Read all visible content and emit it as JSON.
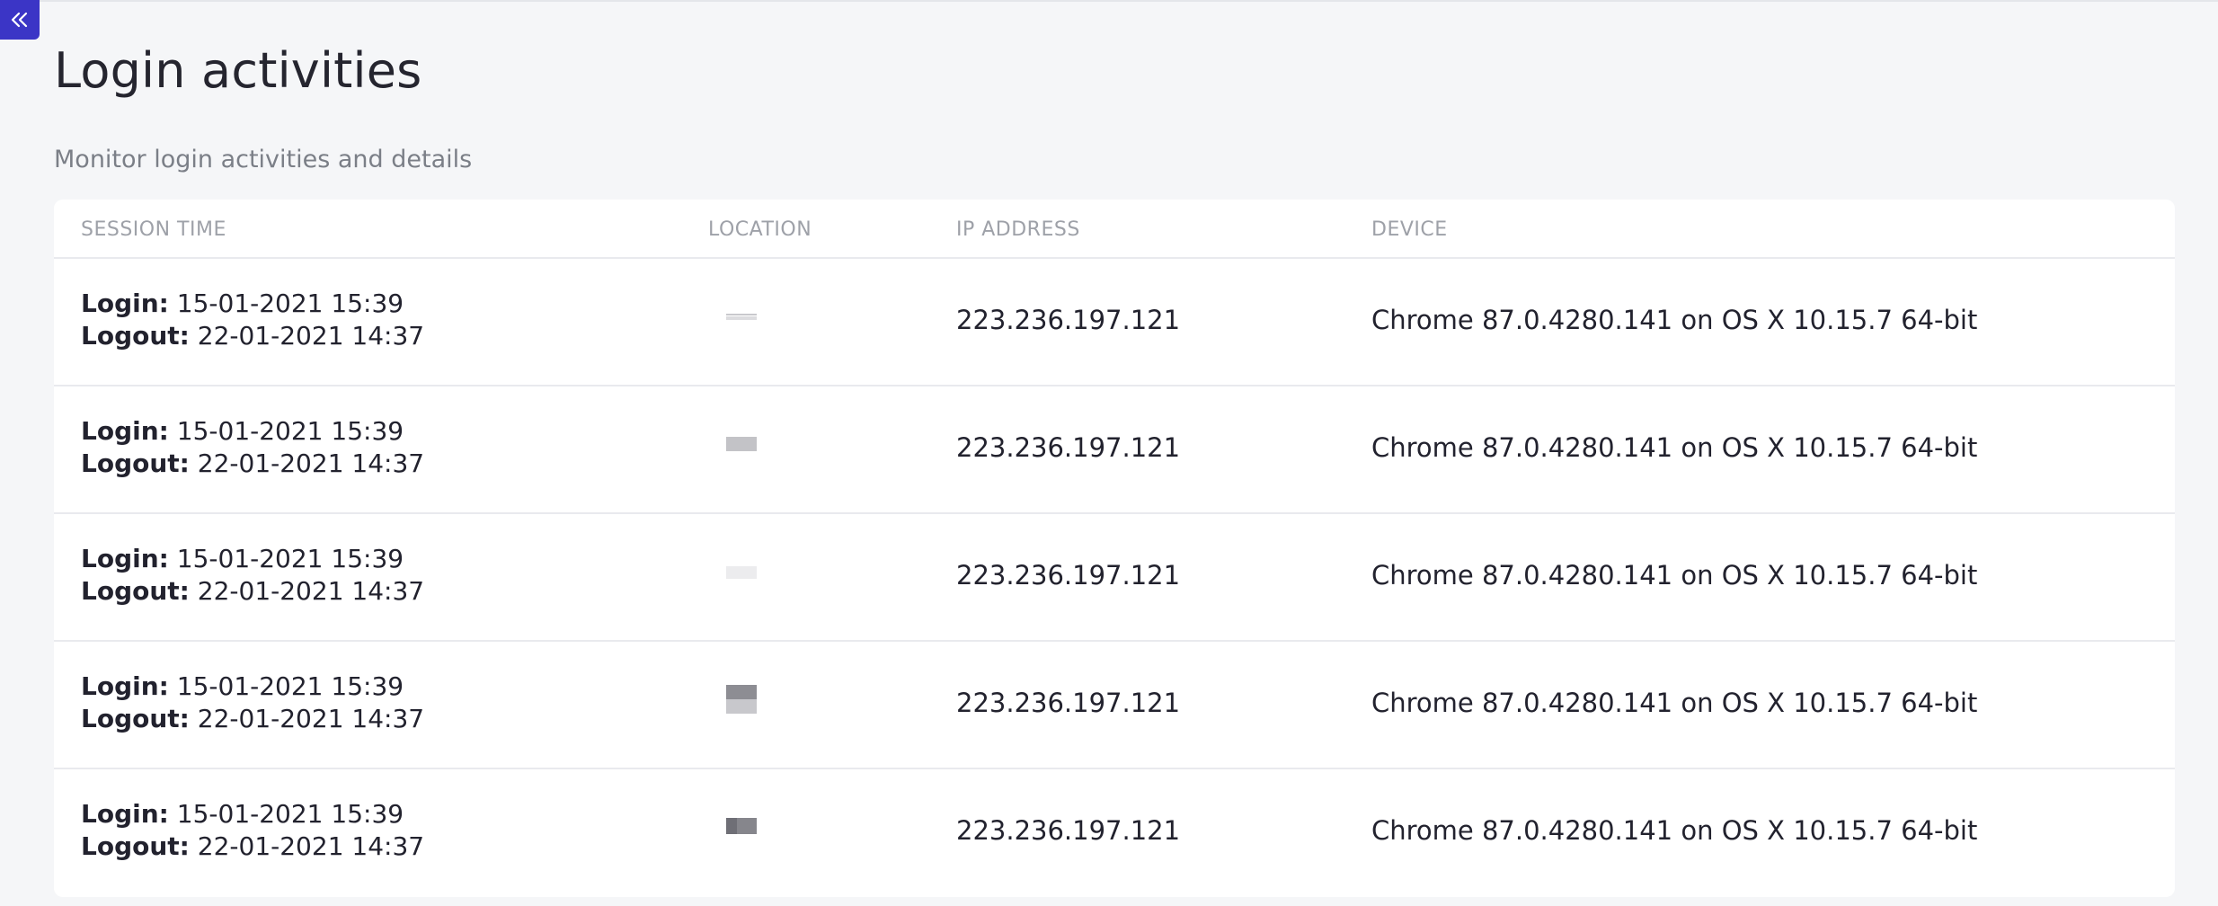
{
  "page": {
    "title": "Login activities",
    "subtitle": "Monitor login activities and details"
  },
  "table": {
    "headers": {
      "session_time": "SESSION TIME",
      "location": "LOCATION",
      "ip_address": "IP ADDRESS",
      "device": "DEVICE"
    },
    "rows": [
      {
        "login_label": "Login:",
        "login": "15-01-2021 15:39",
        "logout_label": "Logout:",
        "logout": "22-01-2021 14:37",
        "ip": "223.236.197.121",
        "device": "Chrome 87.0.4280.141 on OS X 10.15.7 64-bit"
      },
      {
        "login_label": "Login:",
        "login": "15-01-2021 15:39",
        "logout_label": "Logout:",
        "logout": "22-01-2021 14:37",
        "ip": "223.236.197.121",
        "device": "Chrome 87.0.4280.141 on OS X 10.15.7 64-bit"
      },
      {
        "login_label": "Login:",
        "login": "15-01-2021 15:39",
        "logout_label": "Logout:",
        "logout": "22-01-2021 14:37",
        "ip": "223.236.197.121",
        "device": "Chrome 87.0.4280.141 on OS X 10.15.7 64-bit"
      },
      {
        "login_label": "Login:",
        "login": "15-01-2021 15:39",
        "logout_label": "Logout:",
        "logout": "22-01-2021 14:37",
        "ip": "223.236.197.121",
        "device": "Chrome 87.0.4280.141 on OS X 10.15.7 64-bit"
      },
      {
        "login_label": "Login:",
        "login": "15-01-2021 15:39",
        "logout_label": "Logout:",
        "logout": "22-01-2021 14:37",
        "ip": "223.236.197.121",
        "device": "Chrome 87.0.4280.141 on OS X 10.15.7 64-bit"
      }
    ]
  },
  "icons": {
    "collapse": "chevrons-double-left-icon",
    "location": "flag-icon"
  },
  "colors": {
    "accent": "#3b35c6",
    "background": "#f5f6f8",
    "card": "#ffffff",
    "text": "#22222e",
    "muted": "#7b7f87",
    "header_text": "#9ea1a8"
  }
}
